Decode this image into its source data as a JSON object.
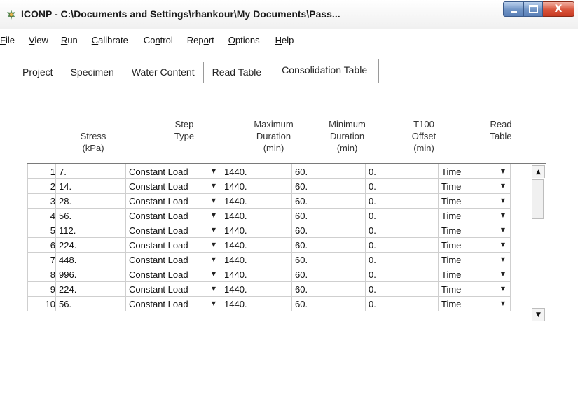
{
  "window": {
    "title": "ICONP - C:\\Documents and Settings\\rhankour\\My Documents\\Pass...",
    "minimize_label": "",
    "maximize_label": "",
    "close_label": "X"
  },
  "menu": {
    "items": [
      {
        "underline": "F",
        "rest": "ile"
      },
      {
        "underline": "V",
        "rest": "iew"
      },
      {
        "underline": "R",
        "rest": "un"
      },
      {
        "underline": "C",
        "rest": "alibrate"
      },
      {
        "pre": "Co",
        "underline": "n",
        "rest": "trol"
      },
      {
        "pre": "Rep",
        "underline": "o",
        "rest": "rt"
      },
      {
        "underline": "O",
        "rest": "ptions"
      },
      {
        "underline": "H",
        "rest": "elp"
      }
    ]
  },
  "tabs": [
    {
      "label": "Project"
    },
    {
      "label": "Specimen"
    },
    {
      "label": "Water Content"
    },
    {
      "label": "Read Table"
    },
    {
      "label": "Consolidation Table",
      "active": true
    }
  ],
  "columns": {
    "stress": [
      "Stress",
      "(kPa)"
    ],
    "step_type": [
      "Step",
      "Type"
    ],
    "max_duration": [
      "Maximum",
      "Duration",
      "(min)"
    ],
    "min_duration": [
      "Minimum",
      "Duration",
      "(min)"
    ],
    "t100": [
      "T100",
      "Offset",
      "(min)"
    ],
    "read_table": [
      "Read",
      "Table"
    ]
  },
  "rows": [
    {
      "n": "1",
      "stress": "7.",
      "step": "Constant Load",
      "max": "1440.",
      "min": "60.",
      "offset": "0.",
      "read": "Time"
    },
    {
      "n": "2",
      "stress": "14.",
      "step": "Constant Load",
      "max": "1440.",
      "min": "60.",
      "offset": "0.",
      "read": "Time"
    },
    {
      "n": "3",
      "stress": "28.",
      "step": "Constant Load",
      "max": "1440.",
      "min": "60.",
      "offset": "0.",
      "read": "Time"
    },
    {
      "n": "4",
      "stress": "56.",
      "step": "Constant Load",
      "max": "1440.",
      "min": "60.",
      "offset": "0.",
      "read": "Time"
    },
    {
      "n": "5",
      "stress": "112.",
      "step": "Constant Load",
      "max": "1440.",
      "min": "60.",
      "offset": "0.",
      "read": "Time"
    },
    {
      "n": "6",
      "stress": "224.",
      "step": "Constant Load",
      "max": "1440.",
      "min": "60.",
      "offset": "0.",
      "read": "Time"
    },
    {
      "n": "7",
      "stress": "448.",
      "step": "Constant Load",
      "max": "1440.",
      "min": "60.",
      "offset": "0.",
      "read": "Time"
    },
    {
      "n": "8",
      "stress": "996.",
      "step": "Constant Load",
      "max": "1440.",
      "min": "60.",
      "offset": "0.",
      "read": "Time"
    },
    {
      "n": "9",
      "stress": "224.",
      "step": "Constant Load",
      "max": "1440.",
      "min": "60.",
      "offset": "0.",
      "read": "Time"
    },
    {
      "n": "10",
      "stress": "56.",
      "step": "Constant Load",
      "max": "1440.",
      "min": "60.",
      "offset": "0.",
      "read": "Time"
    }
  ],
  "icons": {
    "app": "app-icon",
    "dropdown": "dropdown-arrow-icon",
    "scroll_up": "scroll-up-arrow-icon",
    "scroll_down": "scroll-down-arrow-icon"
  },
  "colors": {
    "titlebar_text": "#1a1a1a",
    "close_button": "#d9543b",
    "window_buttons": "#6f93c5"
  }
}
